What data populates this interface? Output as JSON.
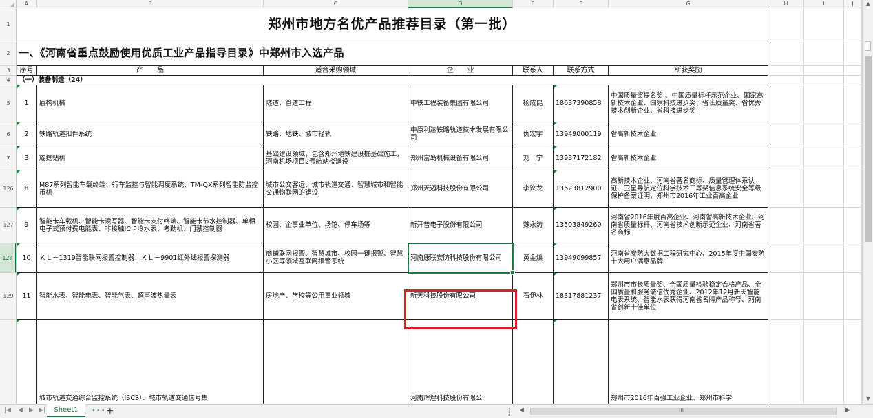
{
  "columns": [
    "A",
    "B",
    "C",
    "D",
    "E",
    "F",
    "G",
    "H",
    "I",
    "J"
  ],
  "selected_column": "D",
  "selected_row": "128",
  "title": "郑州市地方名优产品推荐目录（第一批）",
  "section_title": "一、《河南省重点鼓励使用优质工业产品指导目录》中郑州市入选产品",
  "headers": {
    "seq": "序号",
    "product": "产　　品",
    "field": "适合采购领域",
    "company": "企　　业",
    "contact": "联系人",
    "phone": "联系方式",
    "award": "所获奖励"
  },
  "category": "（一）装备制造（24）",
  "row_labels": {
    "r1": "1",
    "r2": "2",
    "r3": "3",
    "r4": "4"
  },
  "rows": [
    {
      "row_num": "5",
      "seq": "1",
      "product": "盾构机械",
      "field": "隧道、管道工程",
      "company": "中铁工程装备集团有限公司",
      "contact": "杨成昆",
      "phone": "18637390858",
      "award": "中国质量奖提名奖 、中国质量标杆示范企业、国家高新技术企业、国家科技进步奖、省长质量奖、省优秀技术创新企业、省科技进步奖"
    },
    {
      "row_num": "6",
      "seq": "2",
      "product": "铁路轨道扣件系统",
      "field": "铁路、地铁、城市轻轨",
      "company": "中原利达铁路轨道技术发展有限公司",
      "contact": "仇宏宇",
      "phone": "13949000119",
      "award": "省高新技术企业"
    },
    {
      "row_num": "7",
      "seq": "3",
      "product": "旋挖钻机",
      "field": "基础建设领域，包含郑州地铁建设桩基础施工，河南机场项目2号航站楼建设",
      "company": "郑州富岛机械设备有限公司",
      "contact": "刘　宁",
      "phone": "13937172182",
      "award": "省高新技术企业"
    },
    {
      "row_num": "126",
      "seq": "8",
      "product": "M87系列智能车载终端、行车监控与智能调度系统、TM-QX系列智能防监控币机",
      "field": "城市公交客运、城市轨道交通、智慧城市和智能交通物联网的建设",
      "company": "郑州天迈科技股份有限公司",
      "contact": "李汶龙",
      "phone": "13623812900",
      "award": "高新技术企业、河南省著名商标、质量管理体系认证、卫星导航定位科学技术三等奖信息系统安全等级保护备案证明，郑州市2016年工业百高企业"
    },
    {
      "row_num": "127",
      "seq": "9",
      "product": "智能卡车载机、智能卡读写器、智能卡支付终端、智能卡节水控制器、单相电子式预付费电能表、非接触IC卡冷水表、考勤机、门禁控制器",
      "field": "校园、企事业单位、场馆、停车场等",
      "company": "新开普电子股份有限公司",
      "contact": "魏永涛",
      "phone": "13503849260",
      "award": "河南省2016年度百高企业、河南省高新技术企业、河南省质量标杆、河南省技术创新示范企业、河南省著名商标"
    },
    {
      "row_num": "128",
      "seq": "10",
      "product": "ＫＬ－1319智能联网报警控制器、ＫＬ－9901红外线报警探测器",
      "field": "商铺联网报警、智慧城市、校园一键报警、智慧小区等领域互联网报警系统",
      "company": "河南康联安防科技股份有限公司",
      "contact": "黄金焕",
      "phone": "13949099857",
      "award": "河南省安防大数据工程研究中心、2015年度中国安防十大用户满意品牌"
    },
    {
      "row_num": "129",
      "seq": "11",
      "product": "智能水表、智能电表、智能气表、超声波热量表",
      "field": "房地产、学校等公用事业领域",
      "company": "新天科技股份有限公司",
      "contact": "石伊林",
      "phone": "18317881237",
      "award": "郑州市市长质量奖、全国质量检验稳定合格产品、全国质量和服务诚信优秀企业、2012年12月新天智能电表系统、智能水表获得河南省名牌产品称号、河南省创新十佳单位"
    },
    {
      "row_num": "",
      "seq": "",
      "product": "城市轨道交通综合监控系统（ISCS）、城市轨道交通信号集",
      "field": "",
      "company": "河南辉煌科技股份有限公",
      "contact": "",
      "phone": "",
      "award": "郑州市2016年百强工业企业、郑州市科学"
    }
  ],
  "sheet_tab": "Sheet1",
  "sheet_more": "•••",
  "add_sheet": "+",
  "scroll_mark": "III"
}
